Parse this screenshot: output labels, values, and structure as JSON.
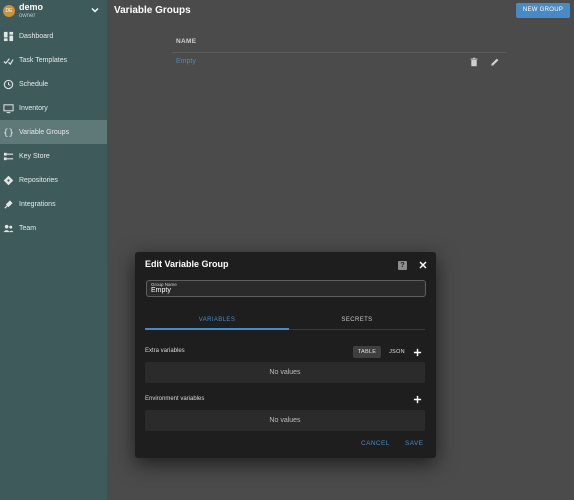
{
  "sidebar": {
    "avatar_initials": "DE",
    "project_name": "demo",
    "role": "owner",
    "items": [
      {
        "label": "Dashboard",
        "icon": "dashboard-icon"
      },
      {
        "label": "Task Templates",
        "icon": "check-list-icon"
      },
      {
        "label": "Schedule",
        "icon": "clock-icon"
      },
      {
        "label": "Inventory",
        "icon": "monitor-icon"
      },
      {
        "label": "Variable Groups",
        "icon": "braces-icon",
        "active": true
      },
      {
        "label": "Key Store",
        "icon": "key-icon"
      },
      {
        "label": "Repositories",
        "icon": "git-icon"
      },
      {
        "label": "Integrations",
        "icon": "plug-icon"
      },
      {
        "label": "Team",
        "icon": "people-icon"
      }
    ]
  },
  "header": {
    "title": "Variable Groups",
    "new_group_label": "NEW GROUP"
  },
  "table": {
    "column_name": "NAME",
    "rows": [
      {
        "name": "Empty"
      }
    ]
  },
  "dialog": {
    "title": "Edit Variable Group",
    "help_label": "?",
    "group_name_label": "Group Name",
    "group_name_value": "Empty",
    "tabs": [
      {
        "label": "VARIABLES",
        "active": true
      },
      {
        "label": "SECRETS",
        "active": false
      }
    ],
    "extra_variables_label": "Extra variables",
    "toggle_table_label": "TABLE",
    "toggle_json_label": "JSON",
    "extra_empty_text": "No values",
    "env_variables_label": "Environment variables",
    "env_empty_text": "No values",
    "cancel_label": "CANCEL",
    "save_label": "SAVE"
  },
  "colors": {
    "sidebar_bg": "#3e5a5a",
    "sidebar_active": "#5f7878",
    "main_bg": "#4b4b4b",
    "accent": "#4a8ac4",
    "dialog_bg": "#1e1e1e",
    "avatar": "#c9923e"
  }
}
